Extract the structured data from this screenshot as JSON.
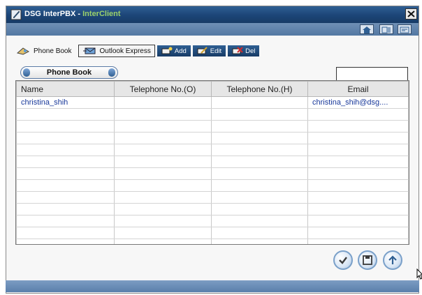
{
  "window": {
    "title_main": "DSG InterPBX - ",
    "title_sub": "InterClient"
  },
  "icons": {
    "app": "pen-icon",
    "close": "close-icon",
    "home": "home-icon",
    "help": "help-icon",
    "minimize": "window-icon"
  },
  "toolbar": {
    "phone_book": "Phone Book",
    "outlook_express": "Outlook Express",
    "add": "Add",
    "edit": "Edit",
    "del": "Del"
  },
  "section": {
    "label": "Phone Book"
  },
  "search": {
    "value": ""
  },
  "table": {
    "headers": [
      "Name",
      "Telephone No.(O)",
      "Telephone No.(H)",
      "Email"
    ],
    "rows": [
      [
        "christina_shih",
        "",
        "",
        "christina_shih@dsg...."
      ],
      [
        "",
        "",
        "",
        ""
      ],
      [
        "",
        "",
        "",
        ""
      ],
      [
        "",
        "",
        "",
        ""
      ],
      [
        "",
        "",
        "",
        ""
      ],
      [
        "",
        "",
        "",
        ""
      ],
      [
        "",
        "",
        "",
        ""
      ],
      [
        "",
        "",
        "",
        ""
      ],
      [
        "",
        "",
        "",
        ""
      ],
      [
        "",
        "",
        "",
        ""
      ],
      [
        "",
        "",
        "",
        ""
      ],
      [
        "",
        "",
        "",
        ""
      ],
      [
        "",
        "",
        "",
        ""
      ]
    ]
  },
  "actions": {
    "confirm": "check-icon",
    "save": "save-icon",
    "upload": "upload-icon"
  },
  "colors": {
    "title_bar": "#1c4577",
    "accent_green": "#9bd16b",
    "link_text": "#18389a"
  }
}
